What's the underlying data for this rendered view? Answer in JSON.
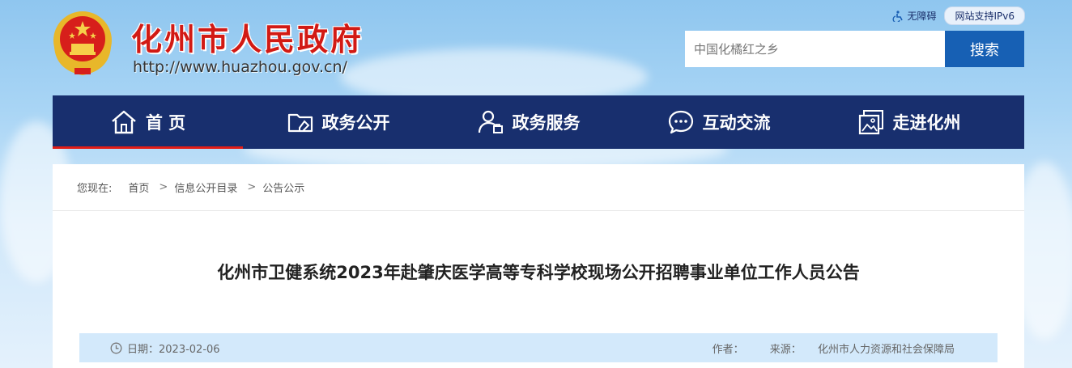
{
  "header": {
    "site_title": "化州市人民政府",
    "site_url": "http://www.huazhou.gov.cn/",
    "accessibility_label": "无障碍",
    "ipv6_label": "网站支持IPv6"
  },
  "search": {
    "placeholder": "中国化橘红之乡",
    "button_label": "搜索"
  },
  "nav": {
    "items": [
      {
        "label": "首 页",
        "icon": "home-icon"
      },
      {
        "label": "政务公开",
        "icon": "folder-icon"
      },
      {
        "label": "政务服务",
        "icon": "user-service-icon"
      },
      {
        "label": "互动交流",
        "icon": "chat-icon"
      },
      {
        "label": "走进化州",
        "icon": "gallery-icon"
      }
    ]
  },
  "breadcrumb": {
    "prefix": "您现在:",
    "items": [
      "首页",
      "信息公开目录",
      "公告公示"
    ]
  },
  "article": {
    "title": "化州市卫健系统2023年赴肇庆医学高等专科学校现场公开招聘事业单位工作人员公告",
    "date_label": "日期：2023-02-06",
    "author_label": "作者：",
    "source_label": "来源：",
    "source_value": "化州市人力资源和社会保障局"
  },
  "colors": {
    "nav_bg": "#182f6e",
    "accent_red": "#e21d17",
    "search_button": "#1760b4",
    "meta_bar": "#d3e9fb"
  }
}
